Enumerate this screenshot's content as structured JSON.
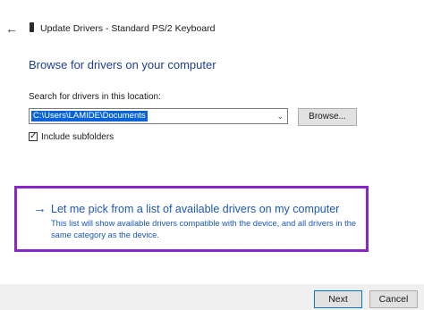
{
  "window": {
    "title": "Update Drivers - Standard PS/2 Keyboard",
    "back_icon": "back-arrow-icon",
    "device_icon": "keyboard-device-icon"
  },
  "main": {
    "heading": "Browse for drivers on your computer",
    "search_label": "Search for drivers in this location:",
    "path_value": "C:\\Users\\LAMIDE\\Documents",
    "browse_label": "Browse...",
    "include_subfolders_label": "Include subfolders",
    "include_subfolders_checked": true
  },
  "pick_option": {
    "title": "Let me pick from a list of available drivers on my computer",
    "description": "This list will show available drivers compatible with the device, and all drivers in the same category as the device.",
    "highlight_color": "#8a26c8"
  },
  "footer": {
    "next_label": "Next",
    "cancel_label": "Cancel"
  }
}
